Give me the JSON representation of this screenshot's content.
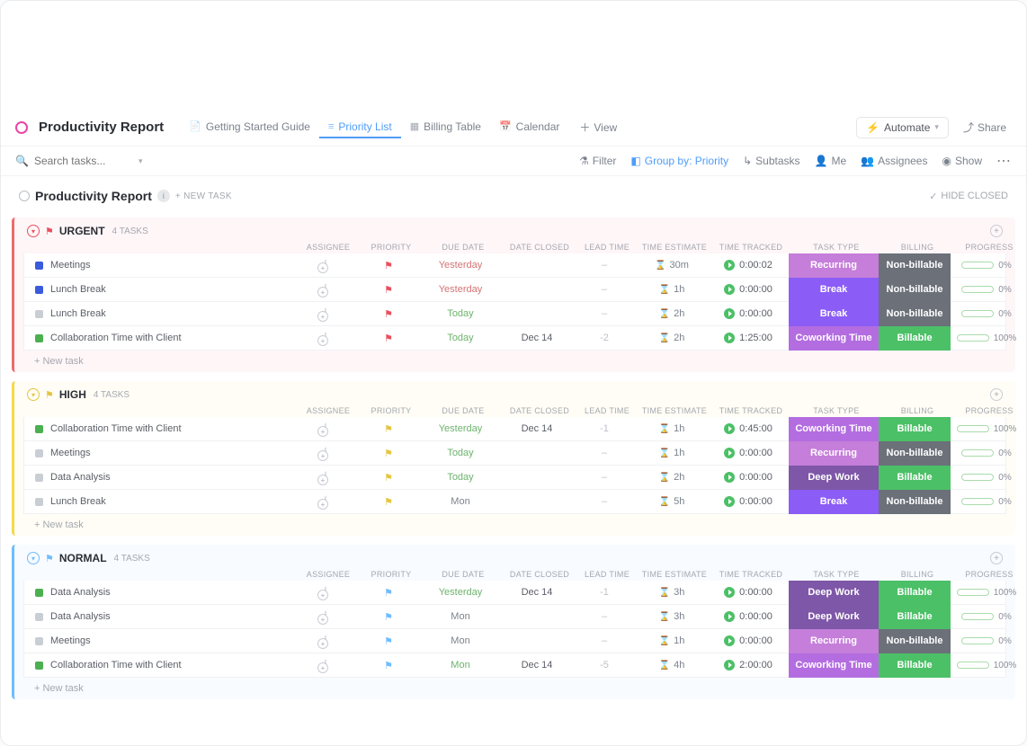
{
  "header": {
    "title": "Productivity Report",
    "tabs": [
      {
        "icon": "📄",
        "label": "Getting Started Guide",
        "active": false
      },
      {
        "icon": "≡",
        "label": "Priority List",
        "active": true
      },
      {
        "icon": "▦",
        "label": "Billing Table",
        "active": false
      },
      {
        "icon": "📅",
        "label": "Calendar",
        "active": false
      }
    ],
    "add_view": "View",
    "automate": "Automate",
    "share": "Share"
  },
  "toolbar": {
    "search_placeholder": "Search tasks...",
    "filter": "Filter",
    "group_by": "Group by: Priority",
    "subtasks": "Subtasks",
    "me": "Me",
    "assignees": "Assignees",
    "show": "Show"
  },
  "sheet": {
    "title": "Productivity Report",
    "new_task": "+ NEW TASK",
    "hide_closed": "HIDE CLOSED"
  },
  "columns": [
    "",
    "ASSIGNEE",
    "PRIORITY",
    "DUE DATE",
    "DATE CLOSED",
    "LEAD TIME",
    "TIME ESTIMATE",
    "TIME TRACKED",
    "TASK TYPE",
    "BILLING",
    "PROGRESS"
  ],
  "new_row": "+ New task",
  "groups": [
    {
      "key": "urgent",
      "name": "URGENT",
      "count": "4 TASKS",
      "flag": "flag-red",
      "rows": [
        {
          "sq": "sq-blue",
          "name": "Meetings",
          "flag": "flag-red",
          "due": "Yesterday",
          "due_cls": "due-red",
          "closed": "",
          "lead": "–",
          "est": "30m",
          "tracked": "0:00:02",
          "tt": "Recurring",
          "tt_cls": "tt-recurring",
          "bill": "Non-billable",
          "bill_cls": "bill-non",
          "prog": 0,
          "prog_txt": "0%"
        },
        {
          "sq": "sq-blue",
          "name": "Lunch Break",
          "flag": "flag-red",
          "due": "Yesterday",
          "due_cls": "due-red",
          "closed": "",
          "lead": "–",
          "est": "1h",
          "tracked": "0:00:00",
          "tt": "Break",
          "tt_cls": "tt-break",
          "bill": "Non-billable",
          "bill_cls": "bill-non",
          "prog": 0,
          "prog_txt": "0%"
        },
        {
          "sq": "sq-grey",
          "name": "Lunch Break",
          "flag": "flag-red",
          "due": "Today",
          "due_cls": "due-green",
          "closed": "",
          "lead": "–",
          "est": "2h",
          "tracked": "0:00:00",
          "tt": "Break",
          "tt_cls": "tt-break",
          "bill": "Non-billable",
          "bill_cls": "bill-non",
          "prog": 0,
          "prog_txt": "0%"
        },
        {
          "sq": "sq-green",
          "name": "Collaboration Time with Client",
          "flag": "flag-red",
          "due": "Today",
          "due_cls": "due-green",
          "closed": "Dec 14",
          "lead": "-2",
          "est": "2h",
          "tracked": "1:25:00",
          "tt": "Coworking Time",
          "tt_cls": "tt-cowork",
          "bill": "Billable",
          "bill_cls": "bill-yes",
          "prog": 100,
          "prog_txt": "100%"
        }
      ]
    },
    {
      "key": "high",
      "name": "HIGH",
      "count": "4 TASKS",
      "flag": "flag-yellow",
      "rows": [
        {
          "sq": "sq-green",
          "name": "Collaboration Time with Client",
          "flag": "flag-yellow",
          "due": "Yesterday",
          "due_cls": "due-green",
          "closed": "Dec 14",
          "lead": "-1",
          "est": "1h",
          "tracked": "0:45:00",
          "tt": "Coworking Time",
          "tt_cls": "tt-cowork",
          "bill": "Billable",
          "bill_cls": "bill-yes",
          "prog": 100,
          "prog_txt": "100%"
        },
        {
          "sq": "sq-grey",
          "name": "Meetings",
          "flag": "flag-yellow",
          "due": "Today",
          "due_cls": "due-green",
          "closed": "",
          "lead": "–",
          "est": "1h",
          "tracked": "0:00:00",
          "tt": "Recurring",
          "tt_cls": "tt-recurring",
          "bill": "Non-billable",
          "bill_cls": "bill-non",
          "prog": 0,
          "prog_txt": "0%"
        },
        {
          "sq": "sq-grey",
          "name": "Data Analysis",
          "flag": "flag-yellow",
          "due": "Today",
          "due_cls": "due-green",
          "closed": "",
          "lead": "–",
          "est": "2h",
          "tracked": "0:00:00",
          "tt": "Deep Work",
          "tt_cls": "tt-deep",
          "bill": "Billable",
          "bill_cls": "bill-yes",
          "prog": 0,
          "prog_txt": "0%"
        },
        {
          "sq": "sq-grey",
          "name": "Lunch Break",
          "flag": "flag-yellow",
          "due": "Mon",
          "due_cls": "due-grey",
          "closed": "",
          "lead": "–",
          "est": "5h",
          "tracked": "0:00:00",
          "tt": "Break",
          "tt_cls": "tt-break",
          "bill": "Non-billable",
          "bill_cls": "bill-non",
          "prog": 0,
          "prog_txt": "0%"
        }
      ]
    },
    {
      "key": "normal",
      "name": "NORMAL",
      "count": "4 TASKS",
      "flag": "flag-blue",
      "rows": [
        {
          "sq": "sq-green",
          "name": "Data Analysis",
          "flag": "flag-blue",
          "due": "Yesterday",
          "due_cls": "due-green",
          "closed": "Dec 14",
          "lead": "-1",
          "est": "3h",
          "tracked": "0:00:00",
          "tt": "Deep Work",
          "tt_cls": "tt-deep",
          "bill": "Billable",
          "bill_cls": "bill-yes",
          "prog": 100,
          "prog_txt": "100%"
        },
        {
          "sq": "sq-grey",
          "name": "Data Analysis",
          "flag": "flag-blue",
          "due": "Mon",
          "due_cls": "due-grey",
          "closed": "",
          "lead": "–",
          "est": "3h",
          "tracked": "0:00:00",
          "tt": "Deep Work",
          "tt_cls": "tt-deep",
          "bill": "Billable",
          "bill_cls": "bill-yes",
          "prog": 0,
          "prog_txt": "0%"
        },
        {
          "sq": "sq-grey",
          "name": "Meetings",
          "flag": "flag-blue",
          "due": "Mon",
          "due_cls": "due-grey",
          "closed": "",
          "lead": "–",
          "est": "1h",
          "tracked": "0:00:00",
          "tt": "Recurring",
          "tt_cls": "tt-recurring",
          "bill": "Non-billable",
          "bill_cls": "bill-non",
          "prog": 0,
          "prog_txt": "0%"
        },
        {
          "sq": "sq-green",
          "name": "Collaboration Time with Client",
          "flag": "flag-blue",
          "due": "Mon",
          "due_cls": "due-green",
          "closed": "Dec 14",
          "lead": "-5",
          "est": "4h",
          "tracked": "2:00:00",
          "tt": "Coworking Time",
          "tt_cls": "tt-cowork",
          "bill": "Billable",
          "bill_cls": "bill-yes",
          "prog": 100,
          "prog_txt": "100%"
        }
      ]
    }
  ]
}
